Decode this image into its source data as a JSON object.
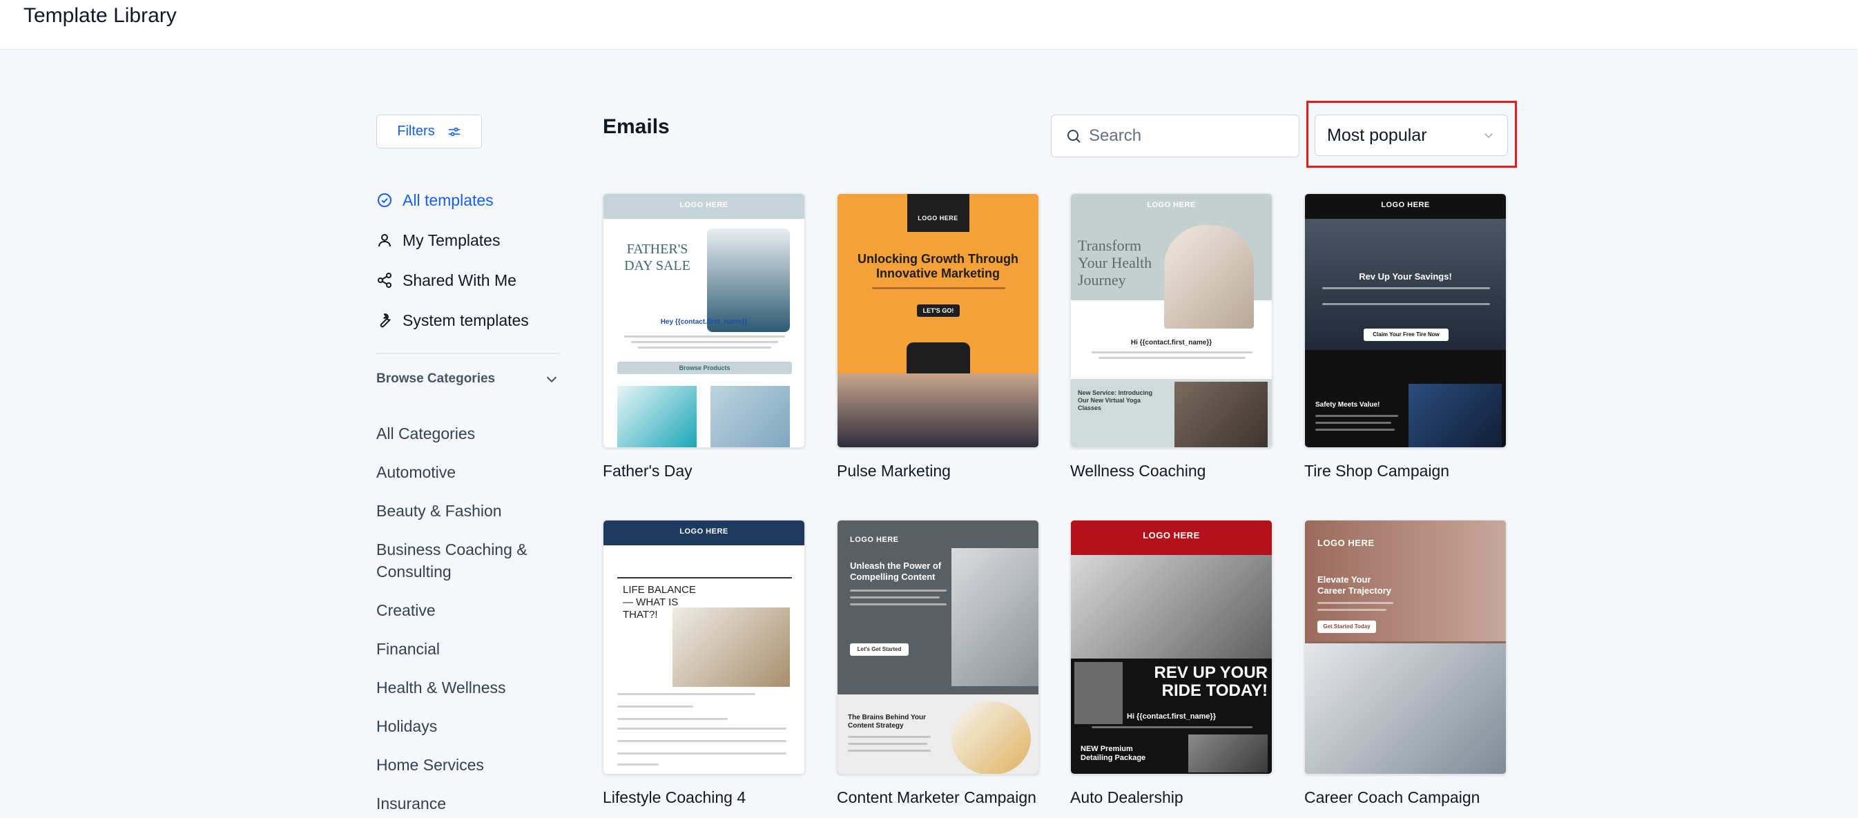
{
  "header": {
    "title": "Template Library"
  },
  "sidebar": {
    "filters_label": "Filters",
    "nav": [
      {
        "label": "All templates",
        "icon": "check-circle-icon",
        "active": true
      },
      {
        "label": "My Templates",
        "icon": "user-icon"
      },
      {
        "label": "Shared With Me",
        "icon": "share-icon"
      },
      {
        "label": "System templates",
        "icon": "wrench-icon"
      }
    ],
    "browse_label": "Browse Categories",
    "categories": [
      "All Categories",
      "Automotive",
      "Beauty & Fashion",
      "Business Coaching & Consulting",
      "Creative",
      "Financial",
      "Health & Wellness",
      "Holidays",
      "Home Services",
      "Insurance"
    ]
  },
  "main": {
    "section_title": "Emails",
    "search": {
      "placeholder": "Search",
      "value": ""
    },
    "sort": {
      "selected": "Most popular"
    },
    "templates": [
      {
        "title": "Father's Day",
        "headline": "FATHER'S DAY SALE",
        "greeting": "Hey {{contact.first_name}}",
        "logo": "LOGO HERE",
        "button": "Browse Products"
      },
      {
        "title": "Pulse Marketing",
        "headline": "Unlocking Growth Through Innovative Marketing",
        "logo": "LOGO HERE",
        "button": "LET'S GO!"
      },
      {
        "title": "Wellness Coaching",
        "headline": "Transform Your Health Journey",
        "greeting": "Hi {{contact.first_name}}",
        "logo": "LOGO HERE",
        "subhead": "New Service: Introducing Our New Virtual Yoga Classes"
      },
      {
        "title": "Tire Shop Campaign",
        "headline": "Rev Up Your Savings!",
        "logo": "LOGO HERE",
        "button": "Claim Your Free Tire Now",
        "subhead": "Safety Meets Value!"
      },
      {
        "title": "Lifestyle Coaching 4",
        "headline": "LIFE BALANCE — WHAT IS THAT?!",
        "logo": "LOGO HERE"
      },
      {
        "title": "Content Marketer Campaign",
        "headline": "Unleash the Power of Compelling Content",
        "logo": "LOGO HERE",
        "button": "Let's Get Started",
        "subhead": "The Brains Behind Your Content Strategy"
      },
      {
        "title": "Auto Dealership",
        "headline": "REV UP YOUR RIDE TODAY!",
        "greeting": "Hi {{contact.first_name}}",
        "logo": "LOGO HERE",
        "subhead": "NEW Premium Detailing Package"
      },
      {
        "title": "Career Coach Campaign",
        "headline": "Elevate Your Career Trajectory",
        "logo": "LOGO HERE",
        "button": "Get Started Today"
      }
    ]
  },
  "colors": {
    "accent": "#155eef",
    "highlight": "#e02020"
  }
}
